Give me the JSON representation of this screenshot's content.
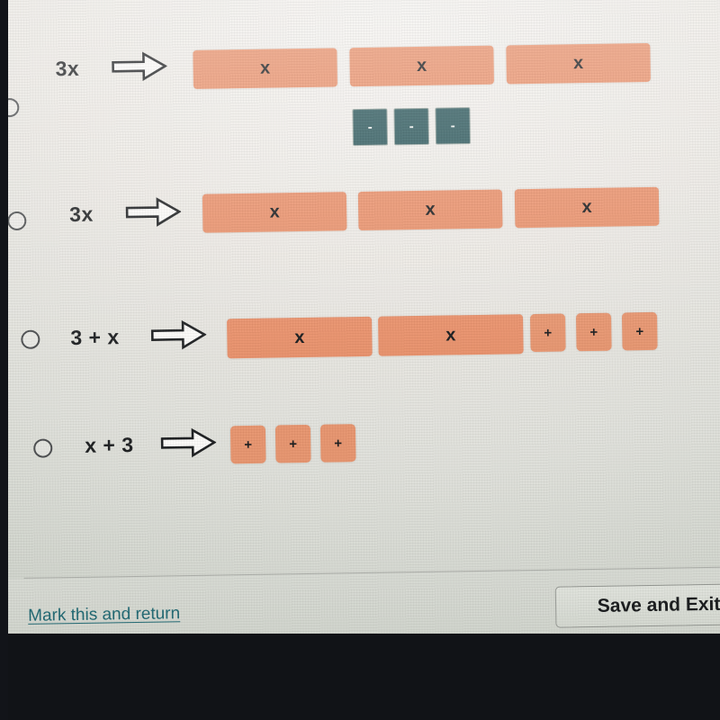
{
  "screen": {
    "top_fragment_text": "|",
    "background_color": "#e8e6e1",
    "tile_x_color": "#e9906a",
    "tile_unit_color": "#e7946e",
    "tile_negative_color": "#2d585c",
    "link_color": "#1e6670"
  },
  "question": {
    "type": "multiple-choice",
    "options": [
      {
        "id": "option-1",
        "expression": "3x",
        "arrow": "right-block-arrow",
        "selected": false,
        "x_tiles": [
          {
            "label": "x"
          },
          {
            "label": "x"
          },
          {
            "label": "x"
          }
        ],
        "unit_tiles": [
          {
            "label": "-",
            "sign": "negative"
          },
          {
            "label": "-",
            "sign": "negative"
          },
          {
            "label": "-",
            "sign": "negative"
          }
        ]
      },
      {
        "id": "option-2",
        "expression": "3x",
        "arrow": "right-block-arrow",
        "selected": false,
        "x_tiles": [
          {
            "label": "x"
          },
          {
            "label": "x"
          },
          {
            "label": "x"
          }
        ],
        "unit_tiles": []
      },
      {
        "id": "option-3",
        "expression": "3 + x",
        "arrow": "right-block-arrow",
        "selected": false,
        "x_tiles": [
          {
            "label": "x"
          },
          {
            "label": "x"
          }
        ],
        "unit_tiles": [
          {
            "label": "+",
            "sign": "positive"
          },
          {
            "label": "+",
            "sign": "positive"
          },
          {
            "label": "+",
            "sign": "positive"
          }
        ]
      },
      {
        "id": "option-4",
        "expression": "x + 3",
        "arrow": "right-block-arrow",
        "selected": false,
        "x_tiles": [],
        "unit_tiles": [
          {
            "label": "+",
            "sign": "positive"
          },
          {
            "label": "+",
            "sign": "positive"
          },
          {
            "label": "+",
            "sign": "positive"
          }
        ]
      }
    ]
  },
  "footer": {
    "mark_link_label": "Mark this and return",
    "save_exit_label": "Save and Exit"
  }
}
